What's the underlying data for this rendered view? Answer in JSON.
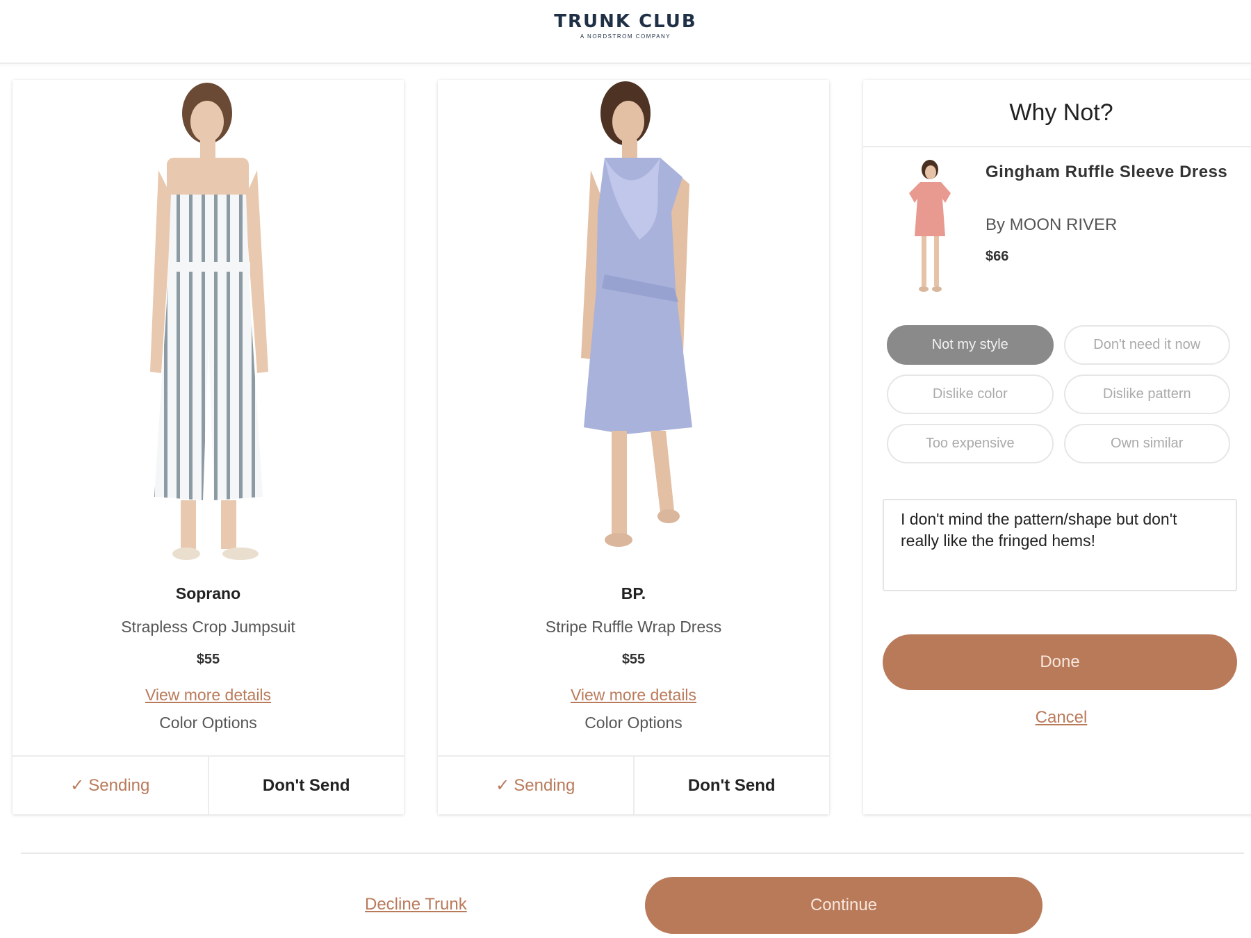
{
  "header": {
    "logo_main": "TRUNK CLUB",
    "logo_sub": "A NORDSTROM COMPANY"
  },
  "products": [
    {
      "brand": "Soprano",
      "name": "Strapless Crop Jumpsuit",
      "price": "$55",
      "details_link": "View more details",
      "color_options": "Color Options",
      "sending_label": "Sending",
      "dont_send_label": "Don't Send"
    },
    {
      "brand": "BP.",
      "name": "Stripe Ruffle Wrap Dress",
      "price": "$55",
      "details_link": "View more details",
      "color_options": "Color Options",
      "sending_label": "Sending",
      "dont_send_label": "Don't Send"
    }
  ],
  "why_not": {
    "title": "Why Not?",
    "item_name": "Gingham Ruffle Sleeve Dress",
    "item_brand": "By MOON RIVER",
    "item_price": "$66",
    "reasons": [
      {
        "label": "Not my style",
        "selected": true
      },
      {
        "label": "Don't need it now",
        "selected": false
      },
      {
        "label": "Dislike color",
        "selected": false
      },
      {
        "label": "Dislike pattern",
        "selected": false
      },
      {
        "label": "Too expensive",
        "selected": false
      },
      {
        "label": "Own similar",
        "selected": false
      }
    ],
    "note_value": "I don't mind the pattern/shape but don't really like the fringed hems!",
    "done_label": "Done",
    "cancel_label": "Cancel"
  },
  "footer": {
    "decline_label": "Decline Trunk",
    "continue_label": "Continue"
  },
  "colors": {
    "accent": "#b97a5a",
    "selected_chip": "#8a8a8a",
    "logo": "#1f2f45"
  }
}
